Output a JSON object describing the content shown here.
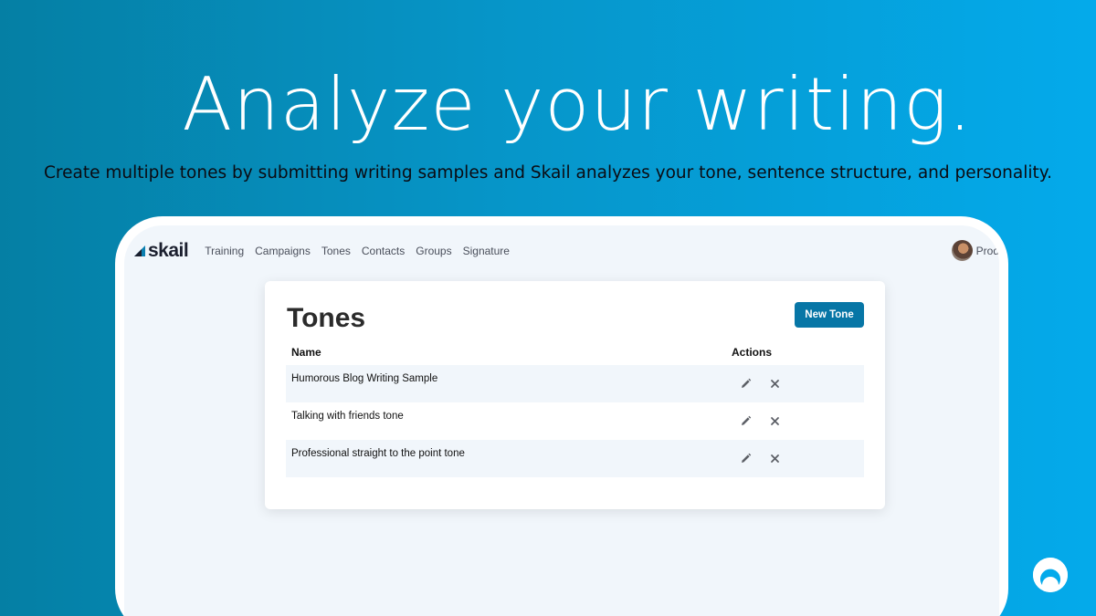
{
  "hero": {
    "title": "Analyze your writing.",
    "subtitle": "Create multiple tones by submitting writing samples and Skail analyzes your tone, sentence structure, and personality."
  },
  "app": {
    "logo_text": "skail",
    "nav": [
      "Training",
      "Campaigns",
      "Tones",
      "Contacts",
      "Groups",
      "Signature"
    ],
    "profile_name": "Prod"
  },
  "tones_page": {
    "title": "Tones",
    "new_button": "New Tone",
    "columns": {
      "name": "Name",
      "actions": "Actions"
    },
    "rows": [
      {
        "name": "Humorous Blog Writing Sample"
      },
      {
        "name": "Talking with friends tone"
      },
      {
        "name": "Professional straight to the point tone"
      }
    ],
    "action_icons": [
      "pencil-icon",
      "close-icon"
    ]
  },
  "colors": {
    "gradient_left": "#057fa4",
    "gradient_right": "#04aaeb",
    "button": "#0776a6",
    "row_shade": "#f1f6fb"
  }
}
